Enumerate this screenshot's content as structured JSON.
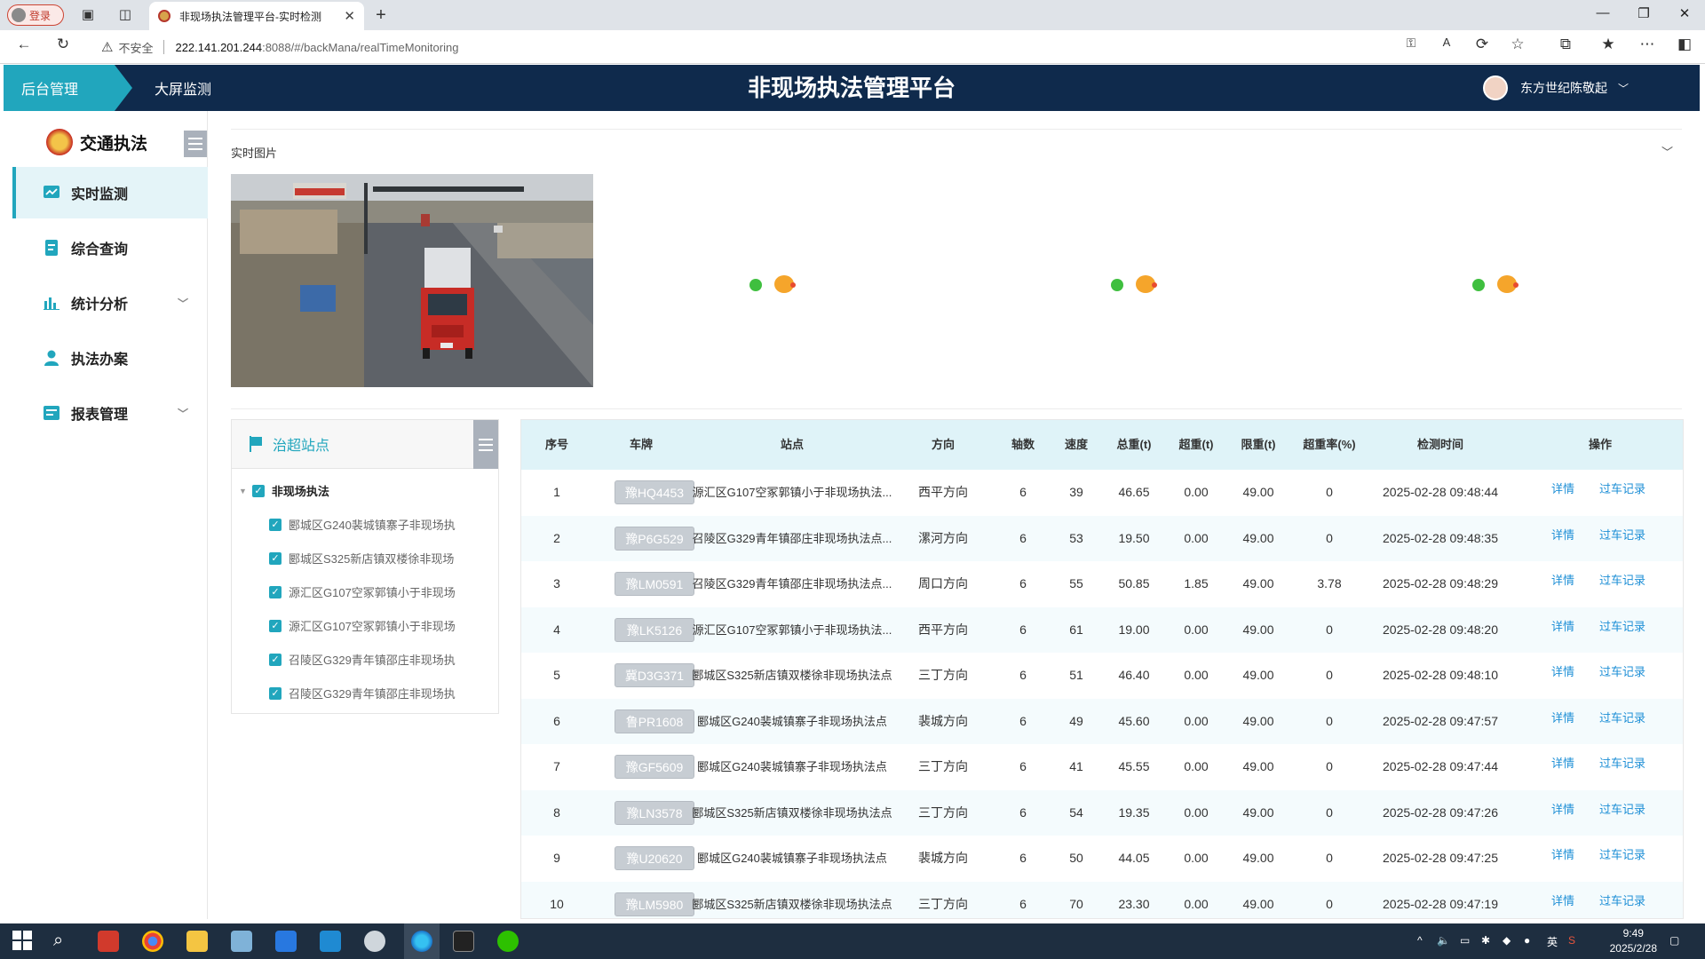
{
  "browser": {
    "login_label": "登录",
    "tab_title": "非现场执法管理平台-实时检测",
    "insecure_label": "不安全",
    "url_host": "222.141.201.244",
    "url_path": ":8088/#/backMana/realTimeMonitoring"
  },
  "header": {
    "tab_backend": "后台管理",
    "tab_bigscreen": "大屏监测",
    "title": "非现场执法管理平台",
    "user_name": "东方世纪陈敬起"
  },
  "sidebar": {
    "logo_text": "交通执法",
    "items": [
      {
        "label": "实时监测",
        "icon": "chart-line-icon",
        "active": true,
        "expandable": false
      },
      {
        "label": "综合查询",
        "icon": "document-icon",
        "active": false,
        "expandable": false
      },
      {
        "label": "统计分析",
        "icon": "bar-chart-icon",
        "active": false,
        "expandable": true
      },
      {
        "label": "执法办案",
        "icon": "person-icon",
        "active": false,
        "expandable": false
      },
      {
        "label": "报表管理",
        "icon": "report-icon",
        "active": false,
        "expandable": true
      }
    ]
  },
  "realtime": {
    "section_title": "实时图片"
  },
  "stations": {
    "title": "治超站点",
    "root": "非现场执法",
    "children": [
      "郾城区G240裴城镇寨子非现场执",
      "郾城区S325新店镇双楼徐非现场",
      "源汇区G107空冢郭镇小于非现场",
      "源汇区G107空冢郭镇小于非现场",
      "召陵区G329青年镇邵庄非现场执",
      "召陵区G329青年镇邵庄非现场执"
    ]
  },
  "table": {
    "headers": [
      "序号",
      "车牌",
      "站点",
      "方向",
      "轴数",
      "速度",
      "总重(t)",
      "超重(t)",
      "限重(t)",
      "超重率(%)",
      "检测时间",
      "操作"
    ],
    "detail_label": "详情",
    "history_label": "过车记录",
    "rows": [
      {
        "no": "1",
        "plate": "豫HQ4453",
        "station": "源汇区G107空冢郭镇小于非现场执法...",
        "direction": "西平方向",
        "axles": "6",
        "speed": "39",
        "total": "46.65",
        "over": "0.00",
        "limit": "49.00",
        "rate": "0",
        "time": "2025-02-28 09:48:44"
      },
      {
        "no": "2",
        "plate": "豫P6G529",
        "station": "召陵区G329青年镇邵庄非现场执法点...",
        "direction": "漯河方向",
        "axles": "6",
        "speed": "53",
        "total": "19.50",
        "over": "0.00",
        "limit": "49.00",
        "rate": "0",
        "time": "2025-02-28 09:48:35"
      },
      {
        "no": "3",
        "plate": "豫LM0591",
        "station": "召陵区G329青年镇邵庄非现场执法点...",
        "direction": "周口方向",
        "axles": "6",
        "speed": "55",
        "total": "50.85",
        "over": "1.85",
        "limit": "49.00",
        "rate": "3.78",
        "time": "2025-02-28 09:48:29"
      },
      {
        "no": "4",
        "plate": "豫LK5126",
        "station": "源汇区G107空冢郭镇小于非现场执法...",
        "direction": "西平方向",
        "axles": "6",
        "speed": "61",
        "total": "19.00",
        "over": "0.00",
        "limit": "49.00",
        "rate": "0",
        "time": "2025-02-28 09:48:20"
      },
      {
        "no": "5",
        "plate": "冀D3G371",
        "station": "郾城区S325新店镇双楼徐非现场执法点",
        "direction": "三丁方向",
        "axles": "6",
        "speed": "51",
        "total": "46.40",
        "over": "0.00",
        "limit": "49.00",
        "rate": "0",
        "time": "2025-02-28 09:48:10"
      },
      {
        "no": "6",
        "plate": "鲁PR1608",
        "station": "郾城区G240裴城镇寨子非现场执法点",
        "direction": "裴城方向",
        "axles": "6",
        "speed": "49",
        "total": "45.60",
        "over": "0.00",
        "limit": "49.00",
        "rate": "0",
        "time": "2025-02-28 09:47:57"
      },
      {
        "no": "7",
        "plate": "豫GF5609",
        "station": "郾城区G240裴城镇寨子非现场执法点",
        "direction": "三丁方向",
        "axles": "6",
        "speed": "41",
        "total": "45.55",
        "over": "0.00",
        "limit": "49.00",
        "rate": "0",
        "time": "2025-02-28 09:47:44"
      },
      {
        "no": "8",
        "plate": "豫LN3578",
        "station": "郾城区S325新店镇双楼徐非现场执法点",
        "direction": "三丁方向",
        "axles": "6",
        "speed": "54",
        "total": "19.35",
        "over": "0.00",
        "limit": "49.00",
        "rate": "0",
        "time": "2025-02-28 09:47:26"
      },
      {
        "no": "9",
        "plate": "豫U20620",
        "station": "郾城区G240裴城镇寨子非现场执法点",
        "direction": "裴城方向",
        "axles": "6",
        "speed": "50",
        "total": "44.05",
        "over": "0.00",
        "limit": "49.00",
        "rate": "0",
        "time": "2025-02-28 09:47:25"
      },
      {
        "no": "10",
        "plate": "豫LM5980",
        "station": "郾城区S325新店镇双楼徐非现场执法点",
        "direction": "三丁方向",
        "axles": "6",
        "speed": "70",
        "total": "23.30",
        "over": "0.00",
        "limit": "49.00",
        "rate": "0",
        "time": "2025-02-28 09:47:19"
      }
    ]
  },
  "taskbar": {
    "ime": "英",
    "time": "9:49",
    "date": "2025/2/28"
  },
  "colors": {
    "header_bg": "#0f2a4c",
    "accent": "#21a6bd",
    "link": "#1e8fd6"
  }
}
